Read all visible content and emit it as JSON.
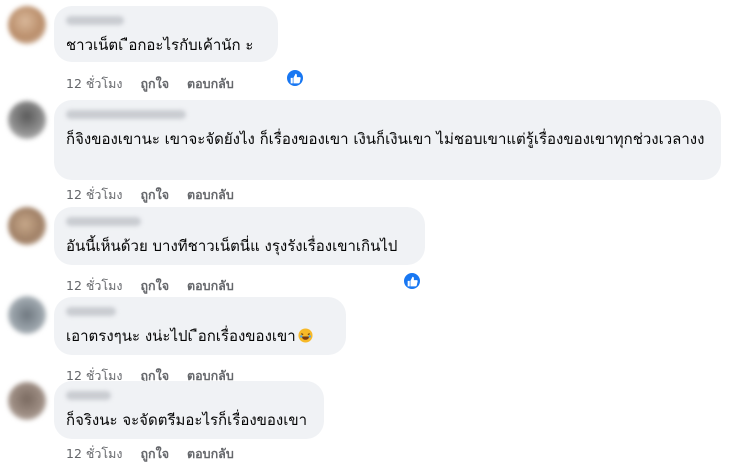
{
  "comments": [
    {
      "text": "ชาวเน็ตเ ือกอะไรกับเค้านัก ะ",
      "time": "12 ชั่วโมง",
      "like": "ถูกใจ",
      "reply": "ตอบกลับ",
      "reacted": true
    },
    {
      "text": "ก็จิงของเขานะ เขาจะจัดยังไง ก็เรื่องของเขา เงินก็เงินเขา ไม่ชอบเขาแต่รู้เรื่องของเขาทุกช่วงเวลางง",
      "time": "12 ชั่วโมง",
      "like": "ถูกใจ",
      "reply": "ตอบกลับ",
      "reacted": false
    },
    {
      "text": "อันนี้เห็นด้วย บางทีชาวเน็ตนี่แ  งรุงรังเรื่องเขาเกินไป",
      "time": "12 ชั่วโมง",
      "like": "ถูกใจ",
      "reply": "ตอบกลับ",
      "reacted": true
    },
    {
      "text": "เอาตรงๆนะ  งน่ะไปเ ือกเรื่องของเขา",
      "time": "12 ชั่วโมง",
      "like": "ถูกใจ",
      "reply": "ตอบกลับ",
      "reacted": false,
      "emoji": "laughing-emoji"
    },
    {
      "text": "ก็จริงนะ จะจัดตรีมอะไรก็เรื่องของเขา",
      "time": "12 ชั่วโมง",
      "like": "ถูกใจ",
      "reply": "ตอบกลับ",
      "reacted": false
    }
  ],
  "colors": {
    "bubble": "#f0f2f5",
    "meta": "#65676b",
    "like_badge": "#1877f2"
  },
  "icons": {
    "reaction": "thumbs-up-icon"
  }
}
